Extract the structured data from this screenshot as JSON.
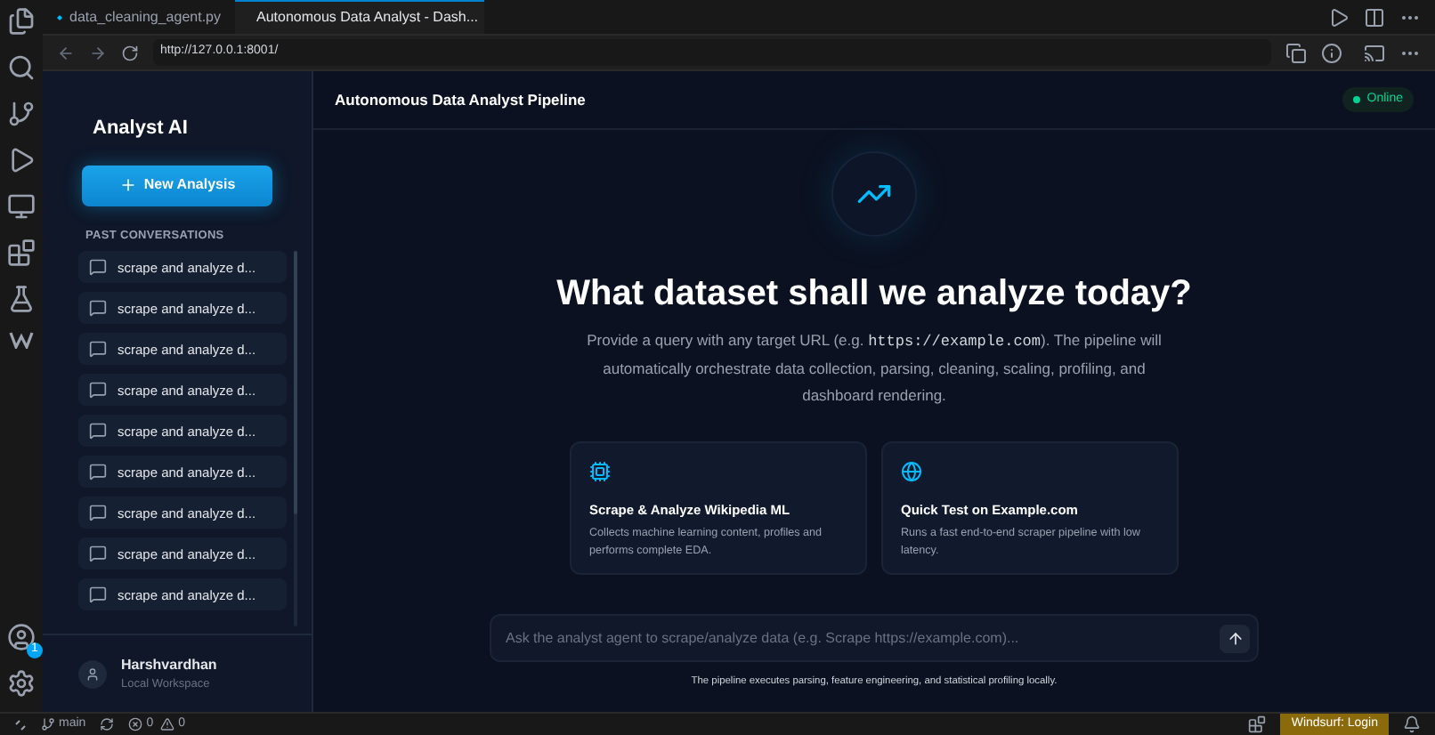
{
  "editor_tabs": [
    {
      "label": "data_cleaning_agent.py",
      "kind": "file",
      "selected": false
    },
    {
      "label": "Autonomous Data Analyst - Dash...",
      "kind": "web",
      "selected": true
    }
  ],
  "address_bar": {
    "url": "http://127.0.0.1:8001/"
  },
  "activity_bar": {
    "account_badge": "1"
  },
  "sidebar": {
    "title": "Analyst AI",
    "new_button": "New Analysis",
    "section": "PAST CONVERSATIONS",
    "conversations": [
      {
        "label": "scrape and analyze d..."
      },
      {
        "label": "scrape and analyze d..."
      },
      {
        "label": "scrape and analyze d..."
      },
      {
        "label": "scrape and analyze d..."
      },
      {
        "label": "scrape and analyze d..."
      },
      {
        "label": "scrape and analyze d..."
      },
      {
        "label": "scrape and analyze d..."
      },
      {
        "label": "scrape and analyze d..."
      },
      {
        "label": "scrape and analyze d..."
      }
    ],
    "user": {
      "name": "Harshvardhan",
      "subtitle": "Local Workspace"
    }
  },
  "header": {
    "title": "Autonomous Data Analyst Pipeline",
    "status": "Online",
    "online": true
  },
  "hero": {
    "heading": "What dataset shall we analyze today?",
    "intro_before": "Provide a query with any target URL (e.g. ",
    "intro_code": "https://example.com",
    "intro_after": "). The pipeline will automatically orchestrate data collection, parsing, cleaning, scaling, profiling, and dashboard rendering."
  },
  "cards": [
    {
      "kind": "chip",
      "title": "Scrape & Analyze Wikipedia ML",
      "text": "Collects machine learning content, profiles and performs complete EDA."
    },
    {
      "kind": "globe",
      "title": "Quick Test on Example.com",
      "text": "Runs a fast end-to-end scraper pipeline with low latency."
    }
  ],
  "composer": {
    "placeholder": "Ask the analyst agent to scrape/analyze data (e.g. Scrape https://example.com)...",
    "footnote": "The pipeline executes parsing, feature engineering, and statistical profiling locally."
  },
  "status_bar": {
    "branch": "main",
    "errors": "0",
    "warnings": "0",
    "login": "Windsurf: Login"
  }
}
